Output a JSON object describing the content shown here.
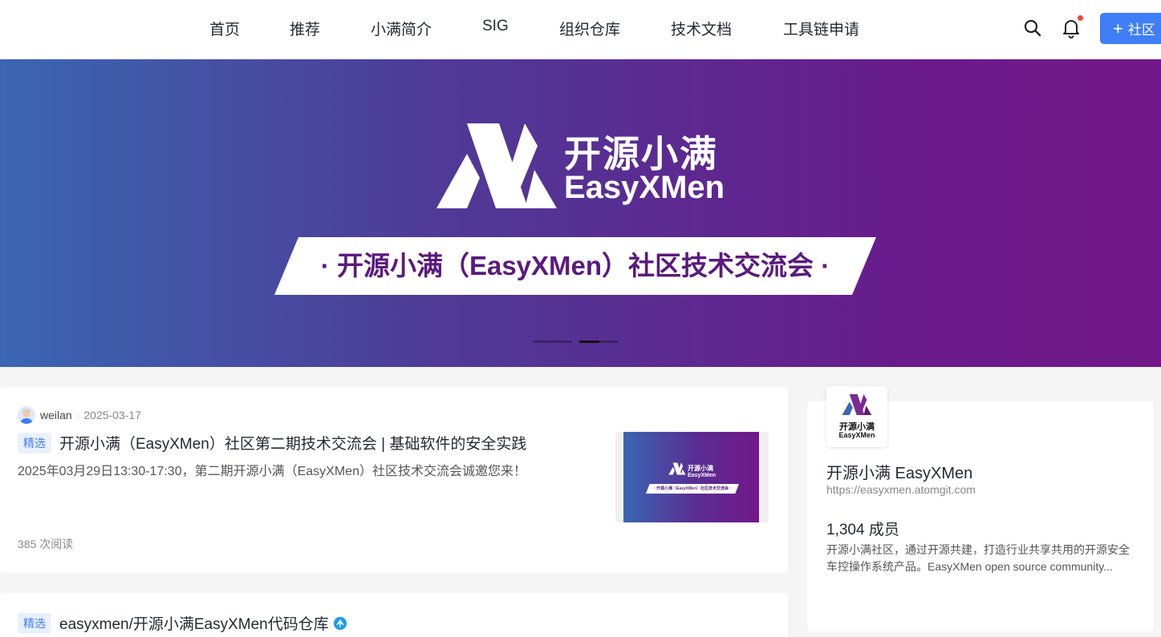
{
  "nav": {
    "items": [
      "首页",
      "推荐",
      "小满简介",
      "SIG",
      "组织仓库",
      "技术文档",
      "工具链申请"
    ],
    "create_button_label": "社区"
  },
  "banner": {
    "logo_cn": "开源小满",
    "logo_en": "EasyXMen",
    "strip_text": "· 开源小满（EasyXMen）社区技术交流会 ·",
    "slide_count": 2,
    "active_slide": 2
  },
  "posts": [
    {
      "author": "weilan",
      "date": "2025-03-17",
      "tag": "精选",
      "title": "开源小满（EasyXMen）社区第二期技术交流会 | 基础软件的安全实践",
      "excerpt": "2025年03月29日13:30-17:30，第二期开源小满（EasyXMen）社区技术交流会诚邀您来！",
      "reads": "385 次阅读",
      "thumb": {
        "cn": "开源小满",
        "en": "EasyXMen",
        "strip": "· 开源小满（EasyXMen）社区技术交流会 ·"
      }
    },
    {
      "tag": "精选",
      "title": "easyxmen/开源小满EasyXMen代码仓库"
    }
  ],
  "sidebar": {
    "logo_cn": "开源小满",
    "logo_en": "EasyXMen",
    "name": "开源小满 EasyXMen",
    "url": "https://easyxmen.atomgit.com",
    "members": "1,304 成员",
    "description": "开源小满社区，通过开源共建，打造行业共享共用的开源安全车控操作系统产品。EasyXMen open source community..."
  },
  "colors": {
    "accent": "#3f7ef7",
    "brand_purple": "#5a1a7e",
    "notification_dot": "#f5453a"
  }
}
